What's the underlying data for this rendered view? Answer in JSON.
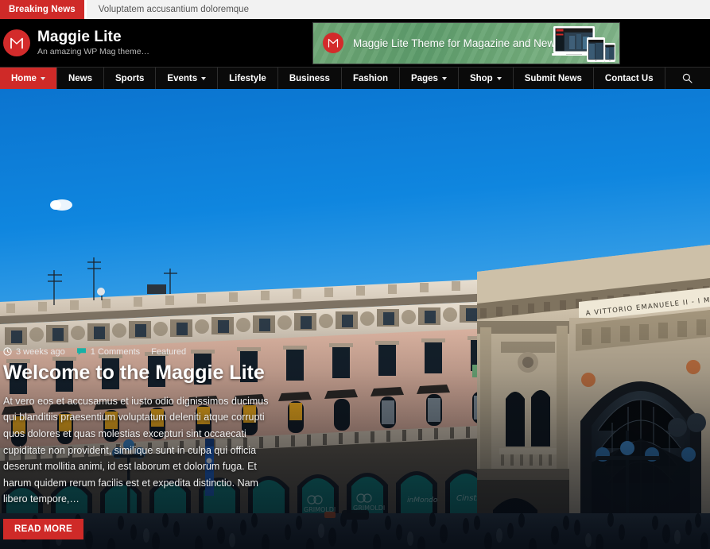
{
  "breaking": {
    "badge_label": "Breaking News",
    "ticker_text": "Voluptatem accusantium doloremque"
  },
  "header": {
    "logo_icon": "maggie-m-monogram",
    "site_title": "Maggie Lite",
    "tagline": "An amazing WP Mag theme…",
    "banner_ad": {
      "logo_icon": "maggie-m-monogram",
      "text": "Maggie Lite Theme for Magazine and News",
      "devices_icon": "responsive-devices-mockup"
    }
  },
  "nav": {
    "items": [
      {
        "label": "Home",
        "has_dropdown": true,
        "active": true
      },
      {
        "label": "News",
        "has_dropdown": false,
        "active": false
      },
      {
        "label": "Sports",
        "has_dropdown": false,
        "active": false
      },
      {
        "label": "Events",
        "has_dropdown": true,
        "active": false
      },
      {
        "label": "Lifestyle",
        "has_dropdown": false,
        "active": false
      },
      {
        "label": "Business",
        "has_dropdown": false,
        "active": false
      },
      {
        "label": "Fashion",
        "has_dropdown": false,
        "active": false
      },
      {
        "label": "Pages",
        "has_dropdown": true,
        "active": false
      },
      {
        "label": "Shop",
        "has_dropdown": true,
        "active": false
      },
      {
        "label": "Submit News",
        "has_dropdown": false,
        "active": false
      },
      {
        "label": "Contact Us",
        "has_dropdown": false,
        "active": false
      }
    ],
    "search_icon": "search-icon"
  },
  "hero": {
    "image_alt": "Galleria Vittorio Emanuele II, Milan — Piazza del Duomo crowd under blue sky",
    "inscription": "A VITTORIO EMANUELE II - I MILANESI",
    "meta": {
      "date_icon": "clock-icon",
      "date": "3 weeks ago",
      "comments_icon": "comment-icon",
      "comments": "1 Comments",
      "category": "Featured"
    },
    "title": "Welcome to the Maggie Lite",
    "excerpt": "At vero eos et accusamus et iusto odio dignissimos ducimus qui blanditiis praesentium voluptatum deleniti atque corrupti quos dolores et quas molestias excepturi sint occaecati cupiditate non provident, similique sunt in culpa qui officia deserunt mollitia animi, id est laborum et dolorum fuga. Et harum quidem rerum facilis est et expedita distinctio. Nam libero tempore,…",
    "read_more_label": "READ MORE"
  },
  "colors": {
    "accent_red": "#cf2a28",
    "header_black": "#000000",
    "ticker_bg": "#f2f2f2",
    "banner_green": "#6fa776",
    "sky_blue": "#0a7fd6",
    "storefront_teal": "#0f7f7a"
  }
}
